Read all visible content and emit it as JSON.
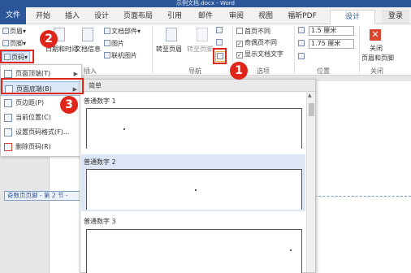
{
  "window": {
    "title": "示例文档.docx - Word"
  },
  "tabs": [
    {
      "label": "文件"
    },
    {
      "label": "开始"
    },
    {
      "label": "插入"
    },
    {
      "label": "设计"
    },
    {
      "label": "页面布局"
    },
    {
      "label": "引用"
    },
    {
      "label": "邮件"
    },
    {
      "label": "审阅"
    },
    {
      "label": "视图"
    },
    {
      "label": "福昕PDF"
    },
    {
      "label": "设计"
    },
    {
      "label": "登录"
    }
  ],
  "ribbon": {
    "header_btn": "页眉",
    "footer_btn": "页脚",
    "page_num_btn": "页码",
    "datetime_btn": "日期和时间",
    "docinfo_btn": "文档信息",
    "docparts_btn": "文档部件",
    "picture_btn": "图片",
    "online_picture_btn": "联机图片",
    "insert_group": "插入",
    "goto_header_btn": "转至页眉",
    "goto_footer_btn": "转至页脚",
    "nav_group": "导航",
    "first_page_diff": "首页不同",
    "odd_even_diff": "奇偶页不同",
    "show_doc_text": "显示文档文字",
    "options_group": "选项",
    "header_pos_value": "1.5 厘米",
    "footer_pos_value": "1.75 厘米",
    "position_group": "位置",
    "close_btn_line1": "关闭",
    "close_btn_line2": "页眉和页脚",
    "close_group": "关闭"
  },
  "menu": {
    "items": [
      {
        "label": "页面顶端(T)"
      },
      {
        "label": "页面底端(B)"
      },
      {
        "label": "页边距(P)"
      },
      {
        "label": "当前位置(C)"
      },
      {
        "label": "设置页码格式(F)..."
      },
      {
        "label": "删除页码(R)"
      }
    ]
  },
  "gallery": {
    "header": "简单",
    "items": [
      {
        "label": "普通数字 1"
      },
      {
        "label": "普通数字 2"
      },
      {
        "label": "普通数字 3"
      }
    ]
  },
  "document": {
    "footer_tag": "奇数页页脚 - 第 2 节 -"
  },
  "annotations": {
    "step1": "1",
    "step2": "2",
    "step3": "3",
    "color": "#e0251b"
  }
}
